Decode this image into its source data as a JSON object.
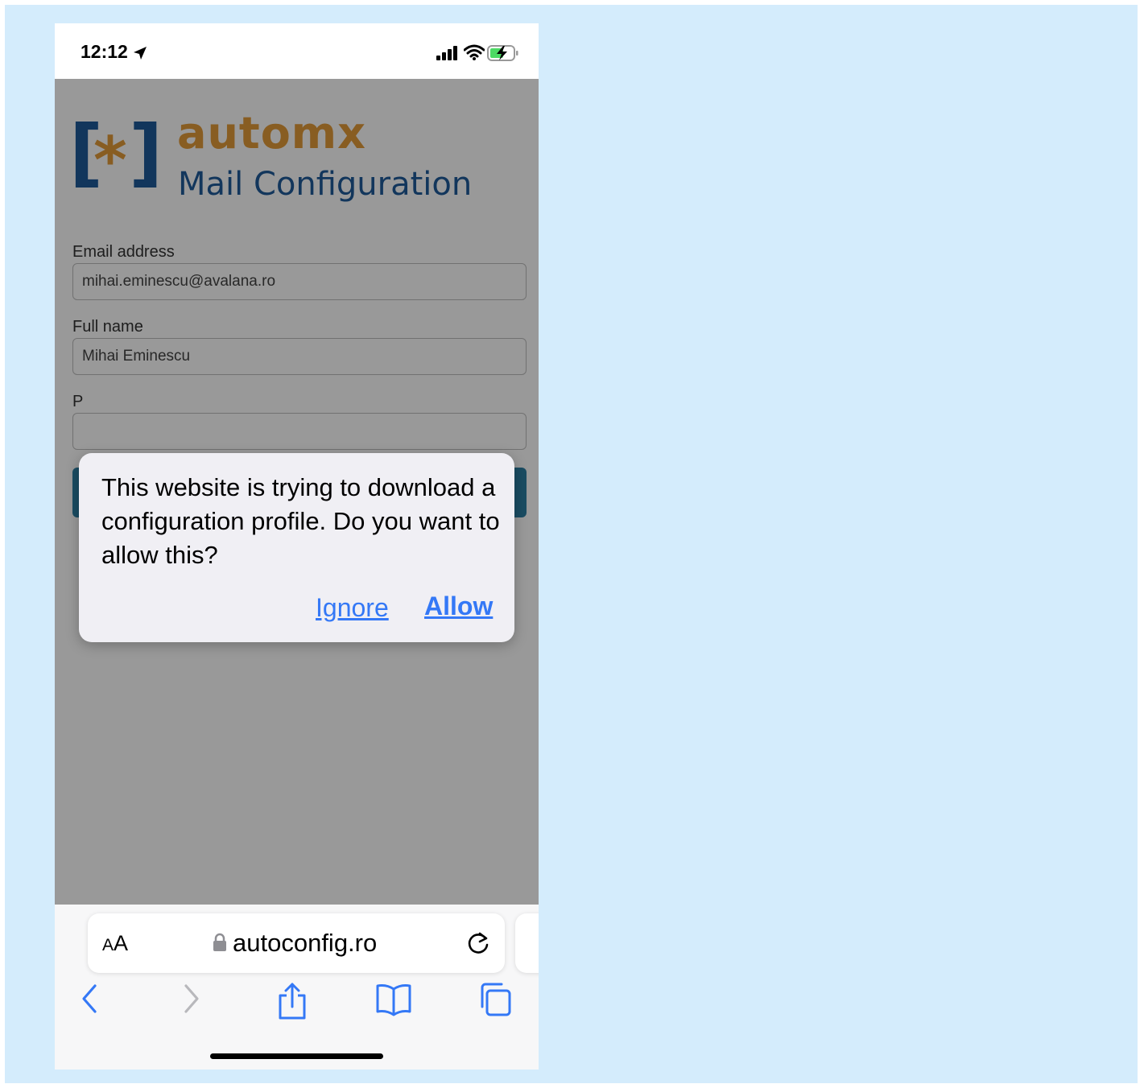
{
  "status_bar": {
    "time": "12:12",
    "icons": [
      "location-arrow-icon",
      "cellular-signal-icon",
      "wifi-icon",
      "battery-charging-icon"
    ]
  },
  "webpage": {
    "logo": {
      "mark_brackets": "[  ]",
      "mark_star": "*",
      "title": "automx",
      "subtitle": "Mail Configuration",
      "colors": {
        "orange": "#e39b3a",
        "blue": "#1e5a9a"
      }
    },
    "form": {
      "email_label": "Email address",
      "email_value": "mihai.eminescu@avalana.ro",
      "fullname_label": "Full name",
      "fullname_value": "Mihai Eminescu",
      "password_label": "P"
    }
  },
  "dialog": {
    "message": "This website is trying to download a configuration profile. Do you want to allow this?",
    "ignore_label": "Ignore",
    "allow_label": "Allow",
    "link_color": "#3478f6"
  },
  "browser": {
    "text_size_button": {
      "small": "A",
      "large": "A"
    },
    "url": "autoconfig.ro",
    "toolbar_icons": [
      "back-icon",
      "forward-icon",
      "share-icon",
      "bookmarks-icon",
      "tabs-icon"
    ]
  }
}
